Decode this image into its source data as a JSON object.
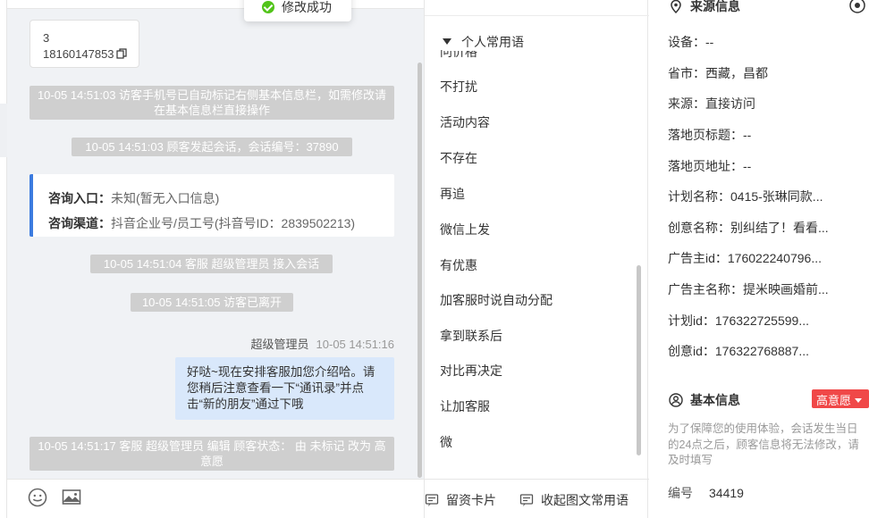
{
  "toast": {
    "text": "修改成功"
  },
  "chat": {
    "phone_card": {
      "line1": "3",
      "line2": "18160147853"
    },
    "system_messages": [
      "10-05 14:51:03 访客手机号已自动标记右侧基本信息栏，如需修改请在基本信息栏直接操作",
      "10-05 14:51:03 顾客发起会话，会话编号：37890",
      "10-05 14:51:04 客服 超级管理员 接入会话",
      "10-05 14:51:05 访客已离开",
      "10-05 14:51:17 客服 超级管理员 编辑 顾客状态： 由 未标记 改为 高意愿"
    ],
    "entry_card": {
      "entry_label": "咨询入口：",
      "entry_value": "未知(暂无入口信息)",
      "channel_label": "咨询渠道：",
      "channel_value": "抖音企业号/员工号(抖音号ID：2839502213)"
    },
    "agent_message": {
      "sender": "超级管理员",
      "time": "10-05 14:51:16",
      "text": "好哒~现在安排客服加您介绍哈。请您稍后注意查看一下“通讯录”并点击“新的朋友”通过下哦"
    },
    "toolbar": {
      "emoji_icon": "smile-icon",
      "image_icon": "image-icon"
    }
  },
  "phrases": {
    "header": "个人常用语",
    "partial_top": "问价格",
    "items": [
      "不打扰",
      "活动内容",
      "不存在",
      "再追",
      "微信上发",
      "有优惠",
      "加客服时说自动分配",
      "拿到联系后",
      "对比再决定",
      "让加客服",
      "微"
    ],
    "footer": {
      "card_btn": "留资卡片",
      "collapse_btn": "收起图文常用语"
    }
  },
  "side": {
    "source_title": "来源信息",
    "source_rows": [
      "设备：--",
      "省市：西藏，昌都",
      "来源：直接访问",
      "落地页标题：--",
      "落地页地址：--",
      "计划名称：0415-张琳同款...",
      "创意名称：别纠结了！看看...",
      "广告主id：176022240796...",
      "广告主名称：提米映画婚前...",
      "计划id：176322725599...",
      "创意id：176322768887..."
    ],
    "basic_title": "基本信息",
    "intent_tag": "高意愿",
    "tip": "为了保障您的使用体验，会话发生当日的24点之后，顾客信息将无法修改，请及时填写",
    "id_label": "编号",
    "id_value": "34419"
  },
  "colors": {
    "accent_blue": "#3c7bdf",
    "tag_red": "#f04848",
    "bubble_bg": "#d9e8fb",
    "success_green": "#52c41a"
  }
}
